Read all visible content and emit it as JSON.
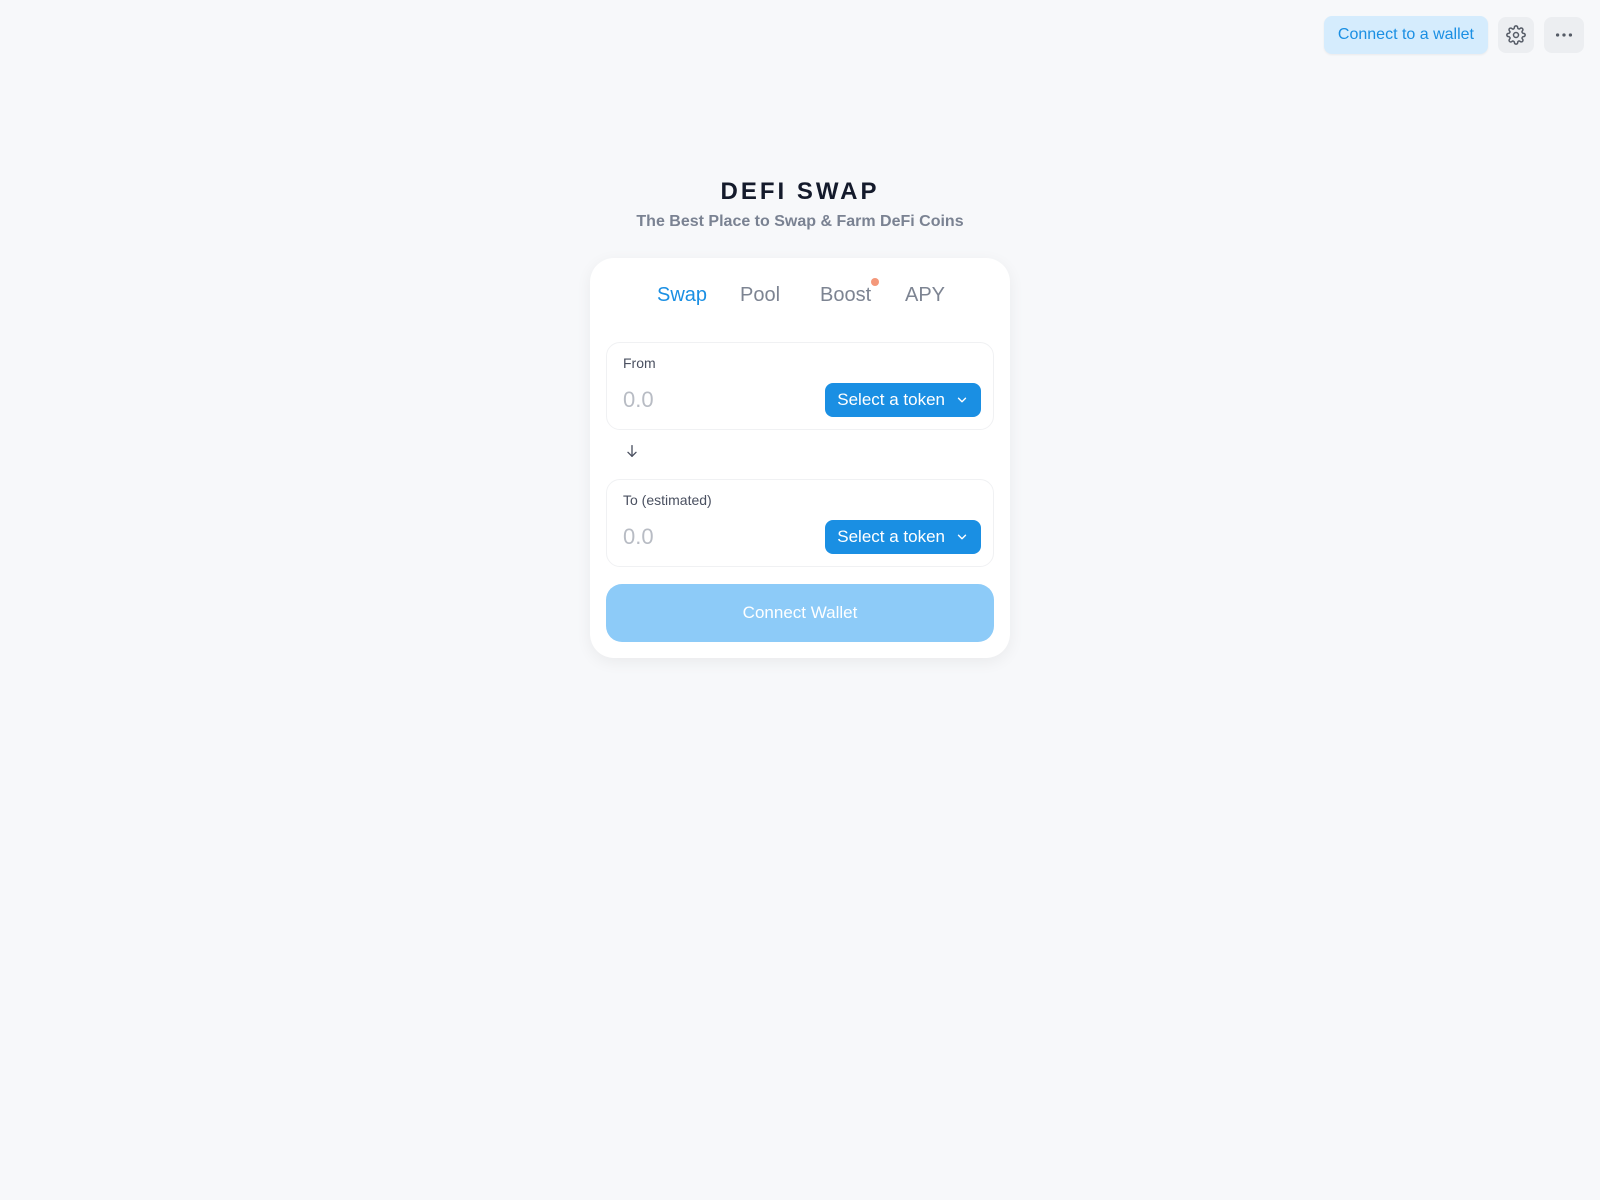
{
  "header": {
    "connect_label": "Connect to a wallet",
    "settings_icon": "gear-icon",
    "more_icon": "more-horizontal-icon"
  },
  "hero": {
    "title": "DEFI SWAP",
    "subtitle": "The Best Place to Swap & Farm DeFi Coins"
  },
  "tabs": [
    {
      "label": "Swap",
      "active": true
    },
    {
      "label": "Pool",
      "active": false
    },
    {
      "label": "Boost",
      "active": false,
      "badge": true
    },
    {
      "label": "APY",
      "active": false
    }
  ],
  "swap": {
    "from": {
      "label": "From",
      "placeholder": "0.0",
      "token_button": "Select a token"
    },
    "to": {
      "label": "To (estimated)",
      "placeholder": "0.0",
      "token_button": "Select a token"
    },
    "connect_button": "Connect Wallet"
  },
  "colors": {
    "accent": "#1a8fe3",
    "accent_light": "#d5ecfd",
    "disabled_button": "#8dcbf8",
    "badge_dot": "#f4987a",
    "background": "#f7f8fa"
  }
}
